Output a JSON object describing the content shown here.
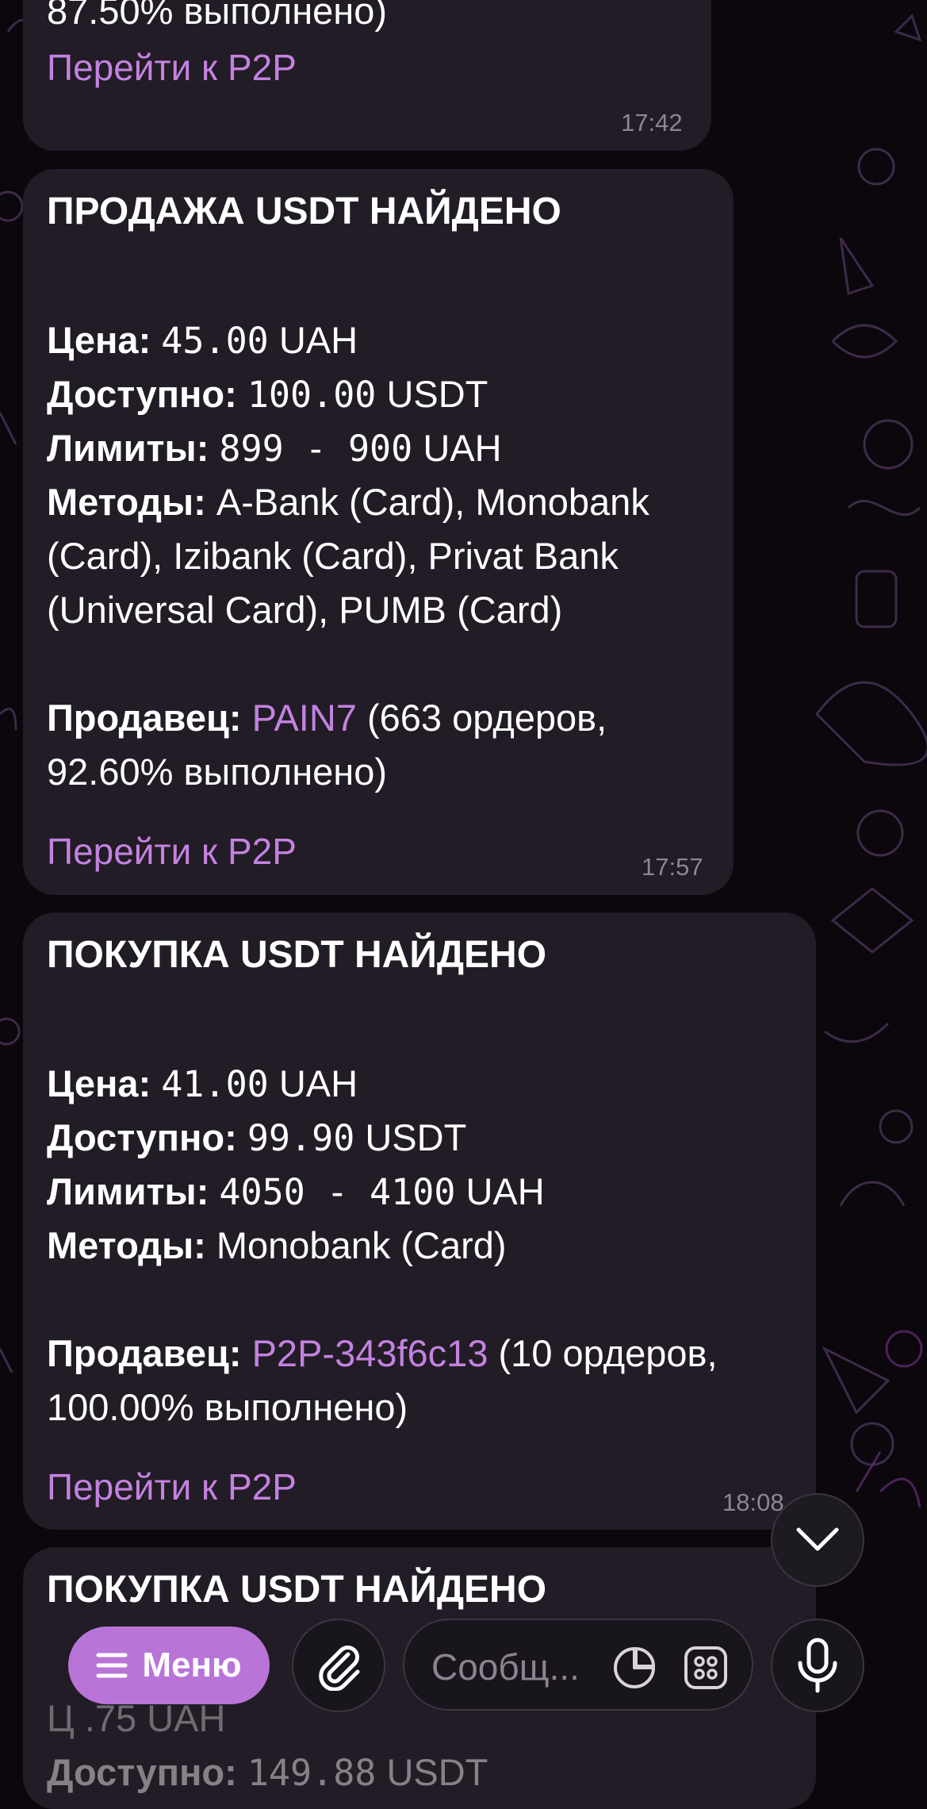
{
  "messages": [
    {
      "partial_line": "87.50% выполнено)",
      "cta": "Перейти к P2P",
      "time": "17:42"
    },
    {
      "title": "ПРОДАЖА USDT НАЙДЕНО",
      "price_label": "Цена:",
      "price_value": "45.00",
      "price_currency": "UAH",
      "available_label": "Доступно:",
      "available_value": "100.00",
      "available_currency": "USDT",
      "limits_label": "Лимиты:",
      "limits_value": "899 - 900",
      "limits_currency": "UAH",
      "methods_label": "Методы:",
      "methods_lines": [
        "A-Bank (Card), Monobank",
        "(Card), Izibank (Card), Privat Bank",
        "(Universal Card), PUMB (Card)"
      ],
      "seller_label": "Продавец:",
      "seller_name": "PAIN7",
      "seller_stats_1": "(663 ордеров,",
      "seller_stats_2": "92.60% выполнено)",
      "cta": "Перейти к P2P",
      "time": "17:57"
    },
    {
      "title": "ПОКУПКА USDT НАЙДЕНО",
      "price_label": "Цена:",
      "price_value": "41.00",
      "price_currency": "UAH",
      "available_label": "Доступно:",
      "available_value": "99.90",
      "available_currency": "USDT",
      "limits_label": "Лимиты:",
      "limits_value": "4050 - 4100",
      "limits_currency": "UAH",
      "methods_label": "Методы:",
      "methods_lines": [
        "Monobank (Card)"
      ],
      "seller_label": "Продавец:",
      "seller_name": "P2P-343f6c13",
      "seller_stats_1": "(10 ордеров,",
      "seller_stats_2": "100.00% выполнено)",
      "cta": "Перейти к P2P",
      "time": "18:08"
    },
    {
      "title": "ПОКУПКА USDT НАЙДЕНО",
      "price_partial": "Ц        .75 UAH",
      "available_label": "Доступно:",
      "available_value": "149.88",
      "available_currency": "USDT"
    }
  ],
  "composer": {
    "menu_label": "Меню",
    "placeholder": "Сообщ..."
  },
  "icons": [
    "chevron-down-icon",
    "menu-icon",
    "paperclip-icon",
    "sticker-icon",
    "keyboard-grid-icon",
    "microphone-icon"
  ],
  "colors": {
    "accent": "#c482e0",
    "menu_button": "#b974d8",
    "bubble": "#211c25",
    "background": "#0b070d"
  }
}
